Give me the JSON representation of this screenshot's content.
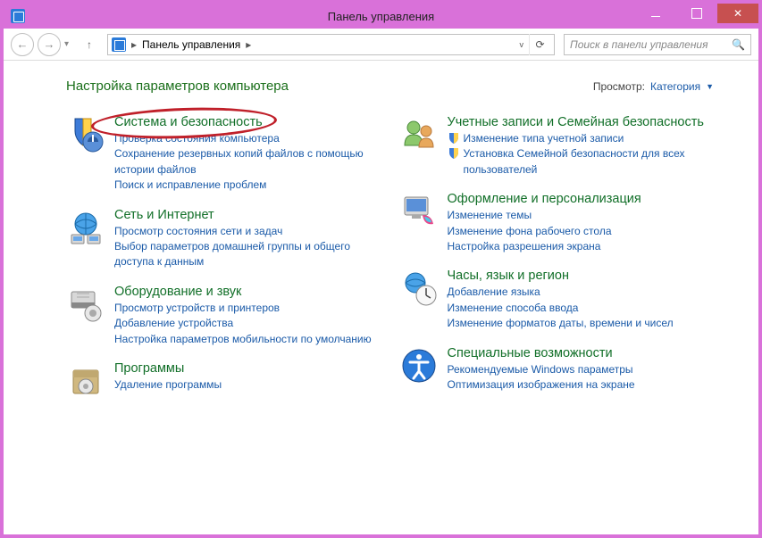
{
  "window": {
    "title": "Панель управления"
  },
  "nav": {
    "breadcrumb": "Панель управления",
    "search_placeholder": "Поиск в панели управления"
  },
  "header": {
    "heading": "Настройка параметров компьютера",
    "view_label": "Просмотр:",
    "view_value": "Категория"
  },
  "categories_left": [
    {
      "title": "Система и безопасность",
      "links": [
        "Проверка состояния компьютера",
        "Сохранение резервных копий файлов с помощью истории файлов",
        "Поиск и исправление проблем"
      ],
      "highlight": true
    },
    {
      "title": "Сеть и Интернет",
      "links": [
        "Просмотр состояния сети и задач",
        "Выбор параметров домашней группы и общего доступа к данным"
      ]
    },
    {
      "title": "Оборудование и звук",
      "links": [
        "Просмотр устройств и принтеров",
        "Добавление устройства",
        "Настройка параметров мобильности по умолчанию"
      ]
    },
    {
      "title": "Программы",
      "links": [
        "Удаление программы"
      ]
    }
  ],
  "categories_right": [
    {
      "title": "Учетные записи и Семейная безопасность",
      "shielded_links": [
        "Изменение типа учетной записи",
        "Установка Семейной безопасности для всех пользователей"
      ]
    },
    {
      "title": "Оформление и персонализация",
      "links": [
        "Изменение темы",
        "Изменение фона рабочего стола",
        "Настройка разрешения экрана"
      ]
    },
    {
      "title": "Часы, язык и регион",
      "links": [
        "Добавление языка",
        "Изменение способа ввода",
        "Изменение форматов даты, времени и чисел"
      ]
    },
    {
      "title": "Специальные возможности",
      "links": [
        "Рекомендуемые Windows параметры",
        "Оптимизация изображения на экране"
      ]
    }
  ]
}
